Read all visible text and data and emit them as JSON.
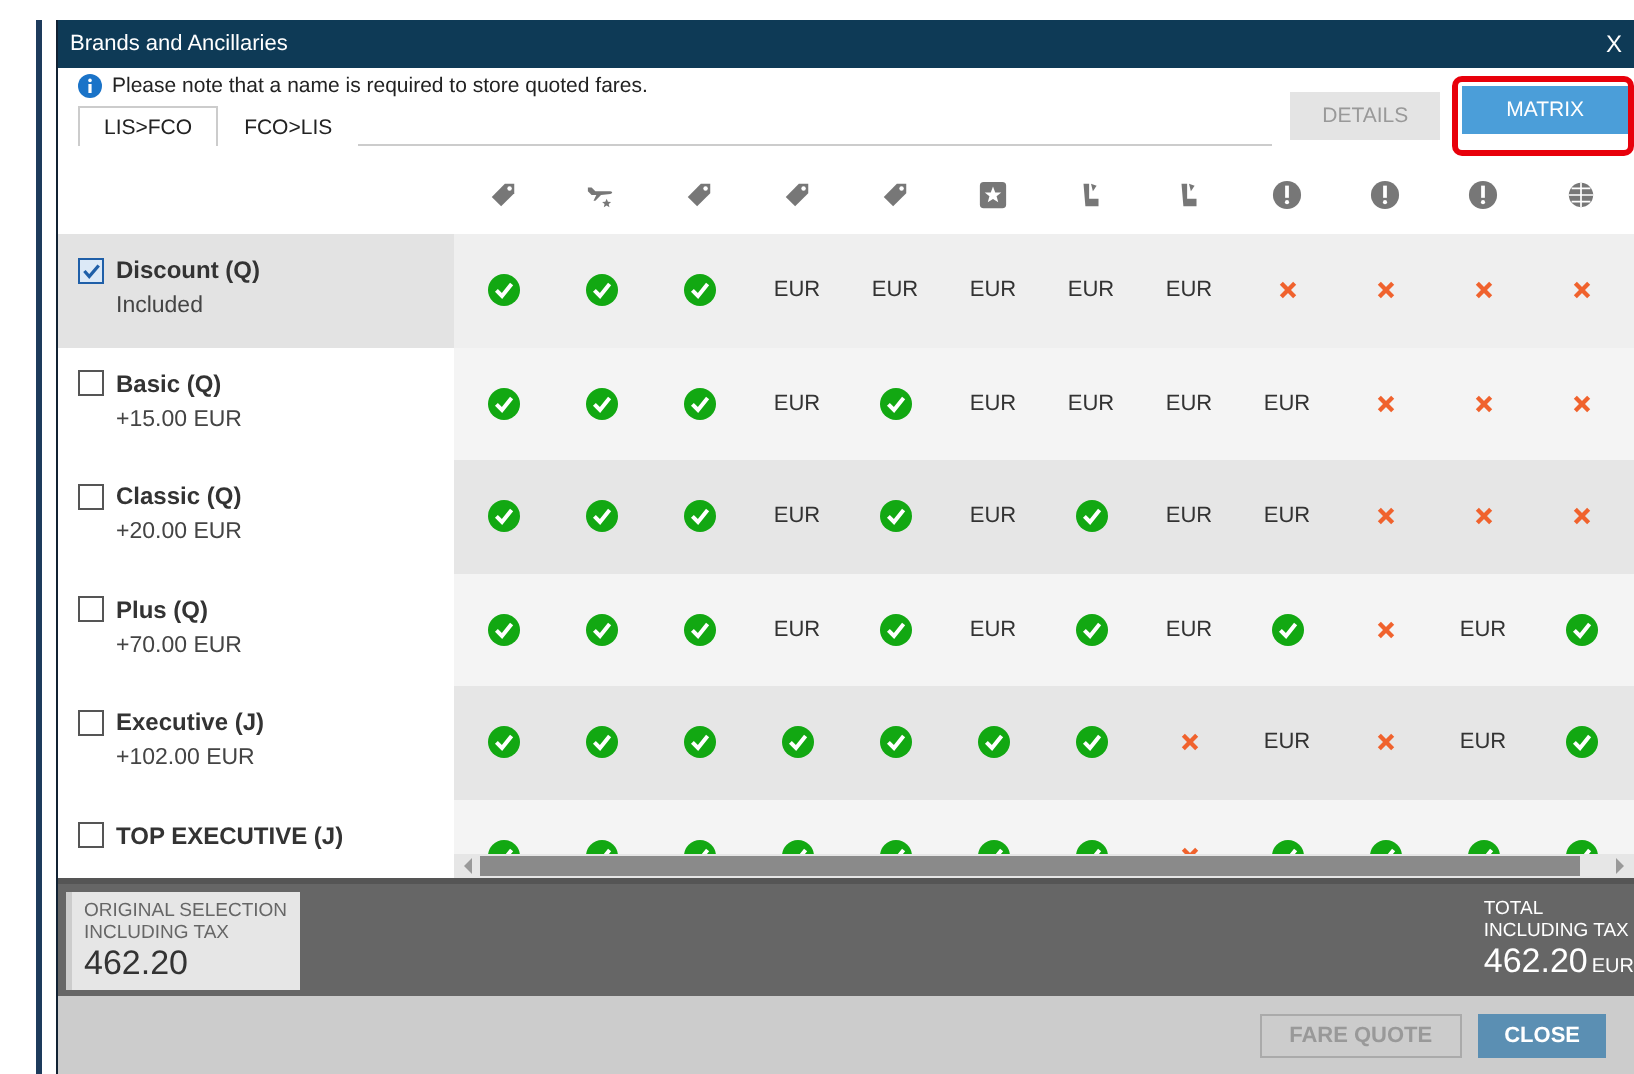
{
  "window": {
    "title": "Brands and Ancillaries",
    "close": "X"
  },
  "notice": "Please note that a name is required to store quoted fares.",
  "route_tabs": [
    {
      "label": "LIS>FCO",
      "selected": true
    },
    {
      "label": "FCO>LIS",
      "selected": false
    }
  ],
  "view_tabs": [
    {
      "label": "DETAILS",
      "selected": false,
      "highlighted": false
    },
    {
      "label": "MATRIX",
      "selected": true,
      "highlighted": true
    }
  ],
  "columns": [
    {
      "kind": "tag"
    },
    {
      "kind": "plane"
    },
    {
      "kind": "tag"
    },
    {
      "kind": "tag"
    },
    {
      "kind": "tag"
    },
    {
      "kind": "star"
    },
    {
      "kind": "seat"
    },
    {
      "kind": "seat"
    },
    {
      "kind": "alert"
    },
    {
      "kind": "alert"
    },
    {
      "kind": "alert"
    },
    {
      "kind": "globe"
    }
  ],
  "brands": [
    {
      "name": "Discount (Q)",
      "price": "Included",
      "checked": true,
      "selected": true,
      "cells": [
        {
          "kind": "check"
        },
        {
          "kind": "check"
        },
        {
          "kind": "check"
        },
        {
          "kind": "text",
          "text": "EUR"
        },
        {
          "kind": "text",
          "text": "EUR"
        },
        {
          "kind": "text",
          "text": "EUR"
        },
        {
          "kind": "text",
          "text": "EUR"
        },
        {
          "kind": "text",
          "text": "EUR"
        },
        {
          "kind": "cross"
        },
        {
          "kind": "cross"
        },
        {
          "kind": "cross"
        },
        {
          "kind": "cross"
        }
      ]
    },
    {
      "name": "Basic (Q)",
      "price": "+15.00 EUR",
      "checked": false,
      "selected": false,
      "cells": [
        {
          "kind": "check"
        },
        {
          "kind": "check"
        },
        {
          "kind": "check"
        },
        {
          "kind": "text",
          "text": "EUR"
        },
        {
          "kind": "check"
        },
        {
          "kind": "text",
          "text": "EUR"
        },
        {
          "kind": "text",
          "text": "EUR"
        },
        {
          "kind": "text",
          "text": "EUR"
        },
        {
          "kind": "text",
          "text": "EUR"
        },
        {
          "kind": "cross"
        },
        {
          "kind": "cross"
        },
        {
          "kind": "cross"
        }
      ]
    },
    {
      "name": "Classic (Q)",
      "price": "+20.00 EUR",
      "checked": false,
      "selected": false,
      "cells": [
        {
          "kind": "check"
        },
        {
          "kind": "check"
        },
        {
          "kind": "check"
        },
        {
          "kind": "text",
          "text": "EUR"
        },
        {
          "kind": "check"
        },
        {
          "kind": "text",
          "text": "EUR"
        },
        {
          "kind": "check"
        },
        {
          "kind": "text",
          "text": "EUR"
        },
        {
          "kind": "text",
          "text": "EUR"
        },
        {
          "kind": "cross"
        },
        {
          "kind": "cross"
        },
        {
          "kind": "cross"
        }
      ]
    },
    {
      "name": "Plus (Q)",
      "price": "+70.00 EUR",
      "checked": false,
      "selected": false,
      "cells": [
        {
          "kind": "check"
        },
        {
          "kind": "check"
        },
        {
          "kind": "check"
        },
        {
          "kind": "text",
          "text": "EUR"
        },
        {
          "kind": "check"
        },
        {
          "kind": "text",
          "text": "EUR"
        },
        {
          "kind": "check"
        },
        {
          "kind": "text",
          "text": "EUR"
        },
        {
          "kind": "check"
        },
        {
          "kind": "cross"
        },
        {
          "kind": "text",
          "text": "EUR"
        },
        {
          "kind": "check"
        }
      ]
    },
    {
      "name": "Executive (J)",
      "price": "+102.00 EUR",
      "checked": false,
      "selected": false,
      "cells": [
        {
          "kind": "check"
        },
        {
          "kind": "check"
        },
        {
          "kind": "check"
        },
        {
          "kind": "check"
        },
        {
          "kind": "check"
        },
        {
          "kind": "check"
        },
        {
          "kind": "check"
        },
        {
          "kind": "cross"
        },
        {
          "kind": "text",
          "text": "EUR"
        },
        {
          "kind": "cross"
        },
        {
          "kind": "text",
          "text": "EUR"
        },
        {
          "kind": "check"
        }
      ]
    },
    {
      "name": "TOP EXECUTIVE (J)",
      "checked": false,
      "selected": false,
      "cells": [
        {
          "kind": "check"
        },
        {
          "kind": "check"
        },
        {
          "kind": "check"
        },
        {
          "kind": "check"
        },
        {
          "kind": "check"
        },
        {
          "kind": "check"
        },
        {
          "kind": "check"
        },
        {
          "kind": "cross"
        },
        {
          "kind": "check"
        },
        {
          "kind": "check"
        },
        {
          "kind": "check"
        },
        {
          "kind": "check"
        }
      ]
    }
  ],
  "original": {
    "label_1": "ORIGINAL SELECTION",
    "label_2": "INCLUDING TAX",
    "amount": "462.20"
  },
  "total": {
    "label_1": "TOTAL",
    "label_2": "INCLUDING TAX",
    "amount": "462.20",
    "currency": "EUR"
  },
  "buttons": [
    {
      "label": "FARE QUOTE",
      "disabled": true
    },
    {
      "label": "CLOSE",
      "disabled": false
    }
  ]
}
